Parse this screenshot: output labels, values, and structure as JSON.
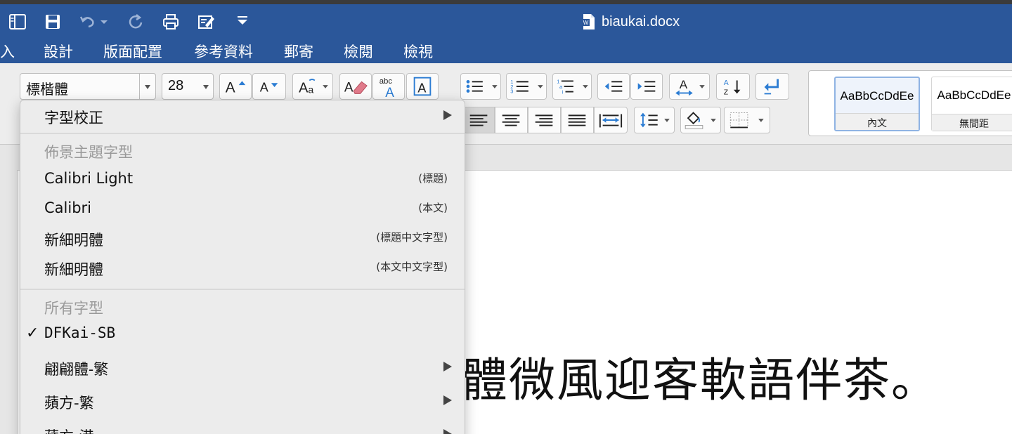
{
  "window": {
    "document_title": "biaukai.docx"
  },
  "quick_access": [
    {
      "name": "sidebar-toggle-icon"
    },
    {
      "name": "save-icon"
    },
    {
      "name": "undo-icon"
    },
    {
      "name": "redo-icon"
    },
    {
      "name": "print-icon"
    },
    {
      "name": "edit-document-icon"
    },
    {
      "name": "customize-toolbar-icon"
    }
  ],
  "menu_tabs": [
    "入",
    "設計",
    "版面配置",
    "參考資料",
    "郵寄",
    "檢閱",
    "檢視"
  ],
  "ribbon": {
    "font_name": "標楷體",
    "font_size": "28",
    "styles": [
      {
        "sample": "AaBbCcDdEe",
        "name": "內文",
        "selected": true
      },
      {
        "sample": "AaBbCcDdEe",
        "name": "無間距",
        "selected": false
      }
    ]
  },
  "font_menu": {
    "item_font_correction": "字型校正",
    "theme_header": "佈景主題字型",
    "theme_fonts": [
      {
        "label": "Calibri Light",
        "hint": "(標題)"
      },
      {
        "label": "Calibri",
        "hint": "(本文)"
      },
      {
        "label": "新細明體",
        "hint": "(標題中文字型)"
      },
      {
        "label": "新細明體",
        "hint": "(本文中文字型)"
      }
    ],
    "all_header": "所有字型",
    "all_fonts": [
      {
        "label": "DFKai-SB",
        "checked": true,
        "submenu": false
      },
      {
        "label": "翩翩體-繁",
        "checked": false,
        "submenu": true
      },
      {
        "label": "蘋方-繁",
        "checked": false,
        "submenu": true
      },
      {
        "label": "蘋方-港",
        "checked": false,
        "submenu": true
      }
    ]
  },
  "document": {
    "visible_text": "體微風迎客軟語伴茶。"
  },
  "colors": {
    "title_bar": "#2b579a",
    "ribbon": "#ededed",
    "menu_bg": "#ececec"
  }
}
